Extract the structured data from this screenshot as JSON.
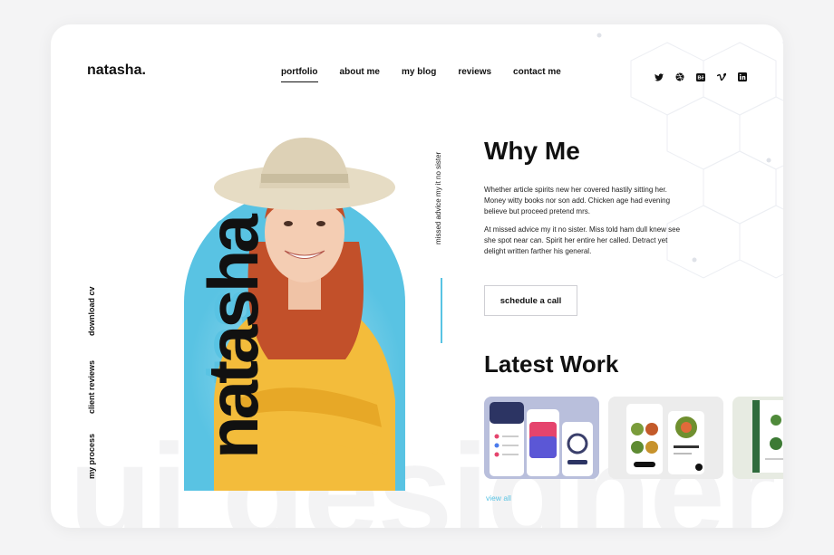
{
  "brand": {
    "logo": "natasha."
  },
  "nav": {
    "items": [
      {
        "label": "portfolio",
        "active": true
      },
      {
        "label": "about me",
        "active": false
      },
      {
        "label": "my blog",
        "active": false
      },
      {
        "label": "reviews",
        "active": false
      },
      {
        "label": "contact me",
        "active": false
      }
    ]
  },
  "social": [
    "twitter-icon",
    "dribbble-icon",
    "behance-icon",
    "vimeo-icon",
    "linkedin-icon"
  ],
  "side_links": [
    "download cv",
    "client reviews",
    "my process"
  ],
  "hero": {
    "name": "natasha",
    "tagline": "missed advice my it no sister",
    "watermark": "ui designer",
    "accent_color": "#59c3e3"
  },
  "why_me": {
    "title": "Why Me",
    "para1": "Whether article spirits new her covered hastily sitting her. Money witty books nor son add. Chicken age had evening believe but proceed pretend mrs.",
    "para2": "At missed advice my it no sister. Miss told ham dull knew see she spot near can. Spirit her entire her called. Detract yet delight written farther his general.",
    "cta": "schedule a call"
  },
  "latest_work": {
    "title": "Latest Work",
    "view_all": "view all"
  }
}
